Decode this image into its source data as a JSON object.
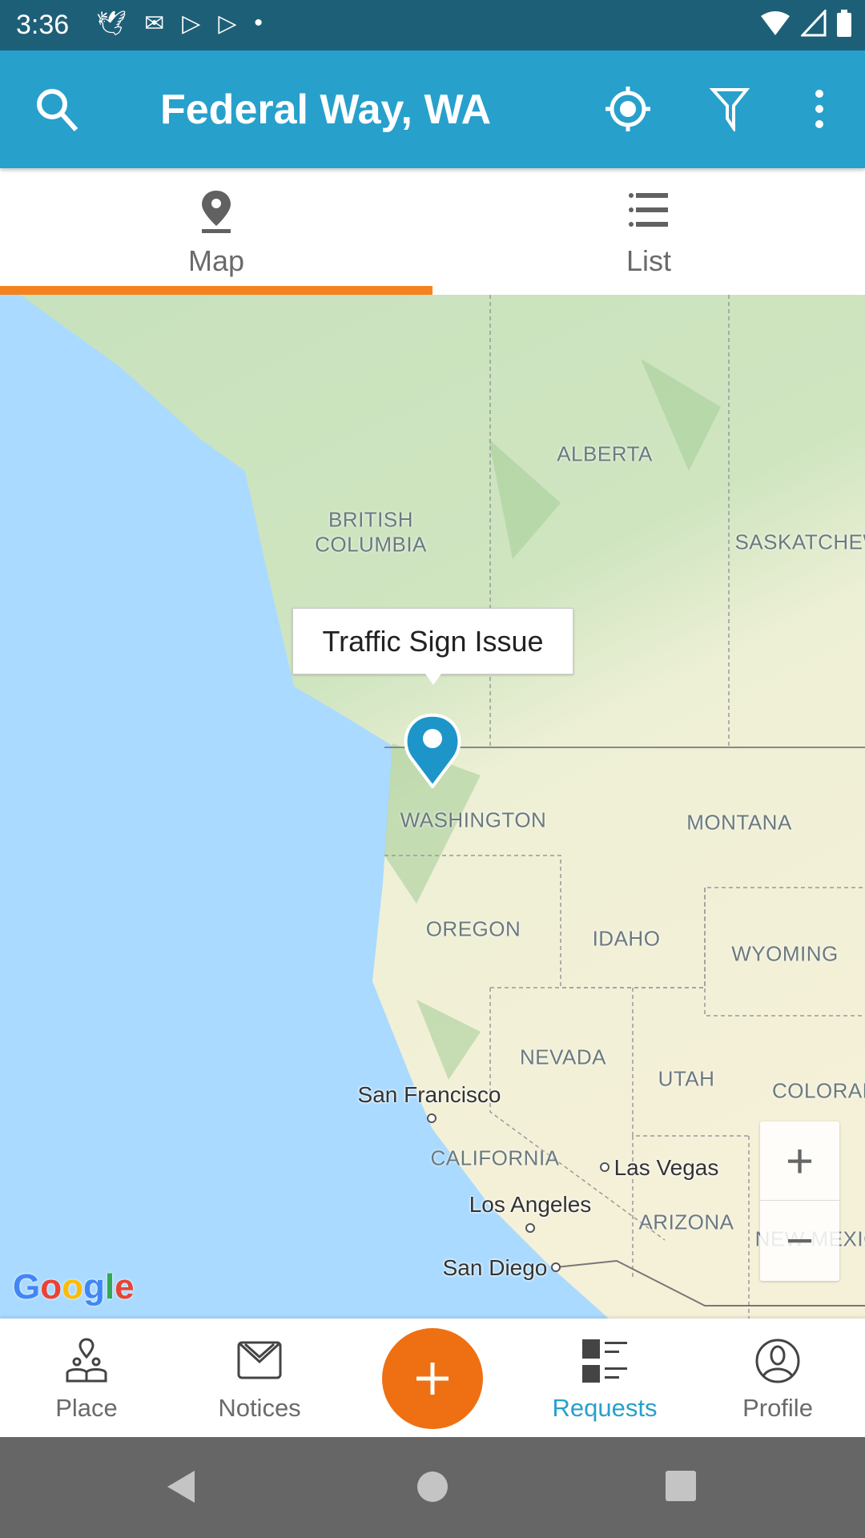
{
  "status_bar": {
    "time": "3:36",
    "notification_icons": [
      "bird-icon",
      "gmail-icon",
      "play-store-icon",
      "play-store-icon",
      "dot-icon"
    ],
    "system_icons": [
      "wifi-icon",
      "signal-icon",
      "battery-icon"
    ]
  },
  "app_bar": {
    "title": "Federal Way, WA",
    "actions": [
      "search-icon",
      "my-location-icon",
      "filter-icon",
      "more-vert-icon"
    ]
  },
  "tabs": [
    {
      "label": "Map",
      "active": true
    },
    {
      "label": "List",
      "active": false
    }
  ],
  "colors": {
    "app_bar": "#27a0cc",
    "status_bar": "#1e5f78",
    "accent": "#f5821f",
    "fab": "#ef7012",
    "active_nav": "#27a0cc"
  },
  "map": {
    "marker_tooltip": "Traffic Sign Issue",
    "region_labels": [
      "ALBERTA",
      "BRITISH",
      "COLUMBIA",
      "SASKATCHEW",
      "WASHINGTON",
      "MONTANA",
      "OREGON",
      "IDAHO",
      "WYOMING",
      "NEVADA",
      "UTAH",
      "COLORAD",
      "CALIFORNIA",
      "ARIZONA",
      "NEW MEXIC"
    ],
    "cities": [
      "San Francisco",
      "Las Vegas",
      "Los Angeles",
      "San Diego"
    ],
    "zoom_in": "+",
    "zoom_out": "−",
    "attribution": "Google"
  },
  "bottom_nav": {
    "items": [
      {
        "label": "Place"
      },
      {
        "label": "Notices"
      },
      {
        "label": "Requests",
        "active": true
      },
      {
        "label": "Profile"
      }
    ],
    "fab": "+"
  }
}
